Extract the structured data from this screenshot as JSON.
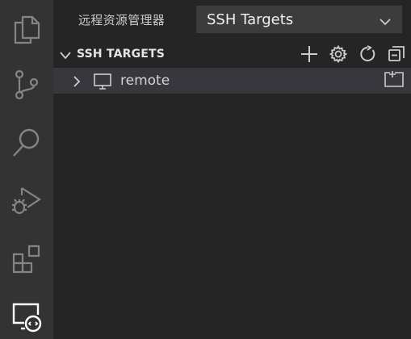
{
  "activity_bar": {
    "items": [
      {
        "name": "explorer",
        "icon": "files-icon"
      },
      {
        "name": "source-control",
        "icon": "source-control-icon"
      },
      {
        "name": "search",
        "icon": "search-icon"
      },
      {
        "name": "run-debug",
        "icon": "run-debug-icon"
      },
      {
        "name": "extensions",
        "icon": "extensions-icon"
      },
      {
        "name": "remote-explorer",
        "icon": "remote-explorer-icon",
        "active": true
      }
    ],
    "icon_color": "#858585",
    "active_icon_color": "#ffffff"
  },
  "sidebar": {
    "title": "远程资源管理器",
    "target_select": {
      "value": "SSH Targets"
    },
    "section": {
      "title": "SSH TARGETS",
      "actions": [
        {
          "name": "add",
          "icon": "plus-icon"
        },
        {
          "name": "configure",
          "icon": "gear-icon"
        },
        {
          "name": "refresh",
          "icon": "refresh-icon"
        },
        {
          "name": "collapse-all",
          "icon": "collapse-all-icon"
        }
      ]
    },
    "tree": [
      {
        "label": "remote",
        "icon": "monitor-icon",
        "action_icon": "open-in-new-window-icon",
        "expanded": false
      }
    ]
  },
  "colors": {
    "activity_bar_bg": "#333333",
    "sidebar_bg": "#252526",
    "select_bg": "#3c3c3c",
    "selected_row_bg": "#37373d",
    "text": "#cccccc"
  }
}
